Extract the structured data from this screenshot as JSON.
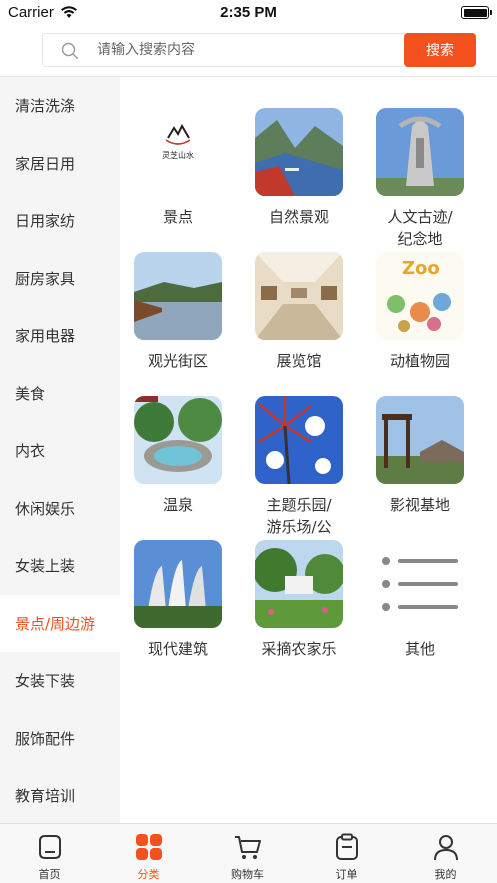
{
  "status_bar": {
    "carrier": "Carrier",
    "time": "2:35 PM"
  },
  "search": {
    "placeholder": "请输入搜索内容",
    "button_label": "搜索"
  },
  "sidebar": {
    "items": [
      {
        "label": "清洁洗涤",
        "active": false
      },
      {
        "label": "家居日用",
        "active": false
      },
      {
        "label": "日用家纺",
        "active": false
      },
      {
        "label": "厨房家具",
        "active": false
      },
      {
        "label": "家用电器",
        "active": false
      },
      {
        "label": "美食",
        "active": false
      },
      {
        "label": "内衣",
        "active": false
      },
      {
        "label": "休闲娱乐",
        "active": false
      },
      {
        "label": "女装上装",
        "active": false
      },
      {
        "label": "景点/周边游",
        "active": true
      },
      {
        "label": "女装下装",
        "active": false
      },
      {
        "label": "服饰配件",
        "active": false
      },
      {
        "label": "教育培训",
        "active": false
      }
    ]
  },
  "categories": [
    {
      "label": "景点",
      "logo_text": "灵芝山水"
    },
    {
      "label": "自然景观"
    },
    {
      "label": "人文古迹/\n纪念地"
    },
    {
      "label": "观光街区"
    },
    {
      "label": "展览馆"
    },
    {
      "label": "动植物园",
      "sign_text": "Zoo"
    },
    {
      "label": "温泉"
    },
    {
      "label": "主题乐园/\n游乐场/公\n园广场"
    },
    {
      "label": "影视基地"
    },
    {
      "label": "现代建筑"
    },
    {
      "label": "采摘农家乐"
    },
    {
      "label": "其他"
    }
  ],
  "tabbar": {
    "tabs": [
      {
        "label": "首页",
        "icon": "home-icon",
        "active": false
      },
      {
        "label": "分类",
        "icon": "category-grid-icon",
        "active": true
      },
      {
        "label": "购物车",
        "icon": "cart-icon",
        "active": false
      },
      {
        "label": "订单",
        "icon": "order-clipboard-icon",
        "active": false
      },
      {
        "label": "我的",
        "icon": "profile-icon",
        "active": false
      }
    ]
  },
  "colors": {
    "accent": "#f4511e",
    "sidebar_bg": "#f5f5f5"
  }
}
